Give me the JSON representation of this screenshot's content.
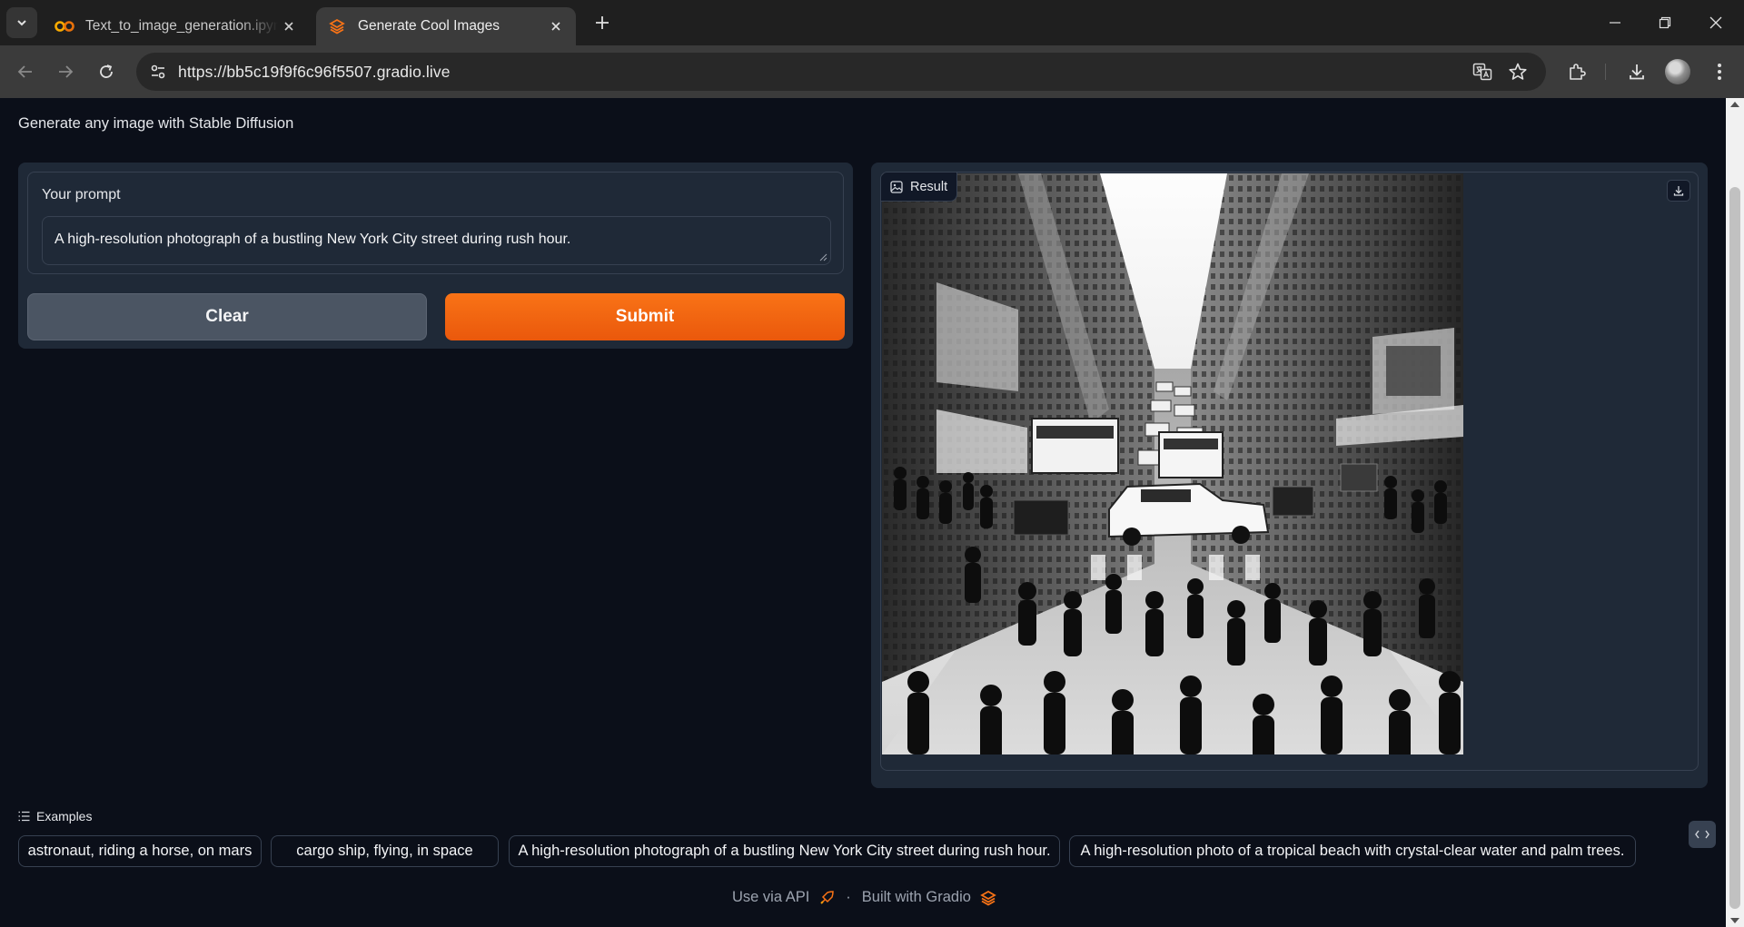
{
  "browser": {
    "tabs": [
      {
        "title": "Text_to_image_generation.ipynb",
        "favicon": "colab-icon",
        "active": false
      },
      {
        "title": "Generate Cool Images",
        "favicon": "gradio-icon",
        "active": true
      }
    ],
    "url": "https://bb5c19f9f6c96f5507.gradio.live"
  },
  "app": {
    "description": "Generate any image with Stable Diffusion",
    "prompt": {
      "label": "Your prompt",
      "value": "A high-resolution photograph of a bustling New York City street during rush hour."
    },
    "buttons": {
      "clear": "Clear",
      "submit": "Submit"
    },
    "result": {
      "label": "Result",
      "image_description": "black and white photo of a crowded New York City street with taxis"
    },
    "examples": {
      "label": "Examples",
      "items": [
        "astronaut, riding a horse, on mars",
        "cargo ship, flying, in space",
        "A high-resolution photograph of a bustling New York City street during rush hour.",
        "A high-resolution photo of a tropical beach with crystal-clear water and palm trees."
      ]
    },
    "footer": {
      "api": "Use via API",
      "separator": "·",
      "built": "Built with Gradio"
    }
  },
  "colors": {
    "background": "#0b0f19",
    "panel": "#1f2937",
    "border": "#374151",
    "accent": "#f97316",
    "secondary_button": "#4b5563"
  }
}
